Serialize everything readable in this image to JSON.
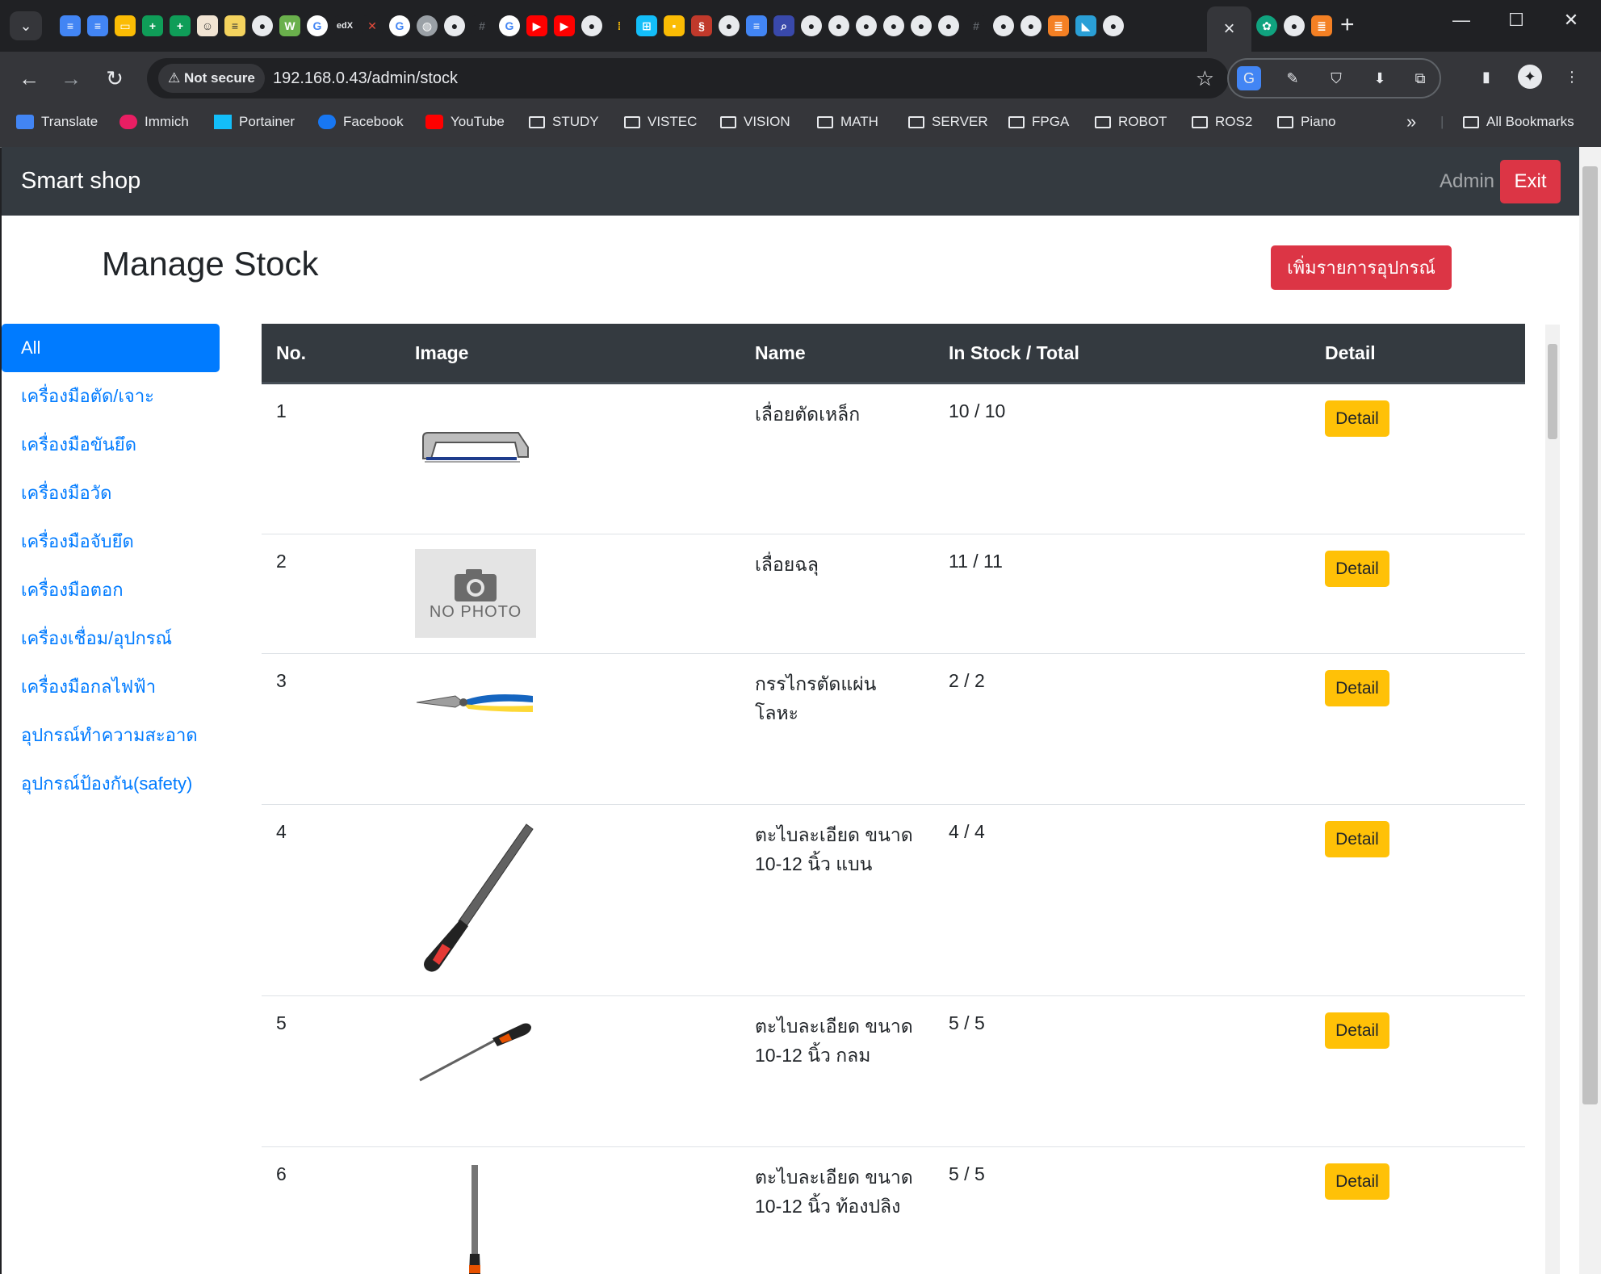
{
  "browser": {
    "new_tab": "+",
    "close_tab": "×",
    "security_label": "Not secure",
    "url": "192.168.0.43/admin/stock",
    "bookmarks": [
      {
        "label": "Translate",
        "icon": "google-translate-icon"
      },
      {
        "label": "Immich",
        "icon": "immich-icon"
      },
      {
        "label": "Portainer",
        "icon": "portainer-icon"
      },
      {
        "label": "Facebook",
        "icon": "facebook-icon"
      },
      {
        "label": "YouTube",
        "icon": "youtube-icon"
      },
      {
        "label": "STUDY",
        "icon": "folder-icon"
      },
      {
        "label": "VISTEC",
        "icon": "folder-icon"
      },
      {
        "label": "VISION",
        "icon": "folder-icon"
      },
      {
        "label": "MATH",
        "icon": "folder-icon"
      },
      {
        "label": "SERVER",
        "icon": "folder-icon"
      },
      {
        "label": "FPGA",
        "icon": "folder-icon"
      },
      {
        "label": "ROBOT",
        "icon": "folder-icon"
      },
      {
        "label": "ROS2",
        "icon": "folder-icon"
      },
      {
        "label": "Piano",
        "icon": "folder-icon"
      }
    ],
    "all_bookmarks": "All Bookmarks",
    "more_bookmarks": "»"
  },
  "app": {
    "brand": "Smart shop",
    "admin_label": "Admin",
    "exit_label": "Exit",
    "page_title": "Manage Stock",
    "add_button": "เพิ่มรายการอุปกรณ์"
  },
  "sidebar": {
    "items": [
      {
        "label": "All",
        "active": true
      },
      {
        "label": "เครื่องมือตัด/เจาะ"
      },
      {
        "label": "เครื่องมือขันยึด"
      },
      {
        "label": "เครื่องมือวัด"
      },
      {
        "label": "เครื่องมือจับยึด"
      },
      {
        "label": "เครื่องมือตอก"
      },
      {
        "label": "เครื่องเชื่อม/อุปกรณ์"
      },
      {
        "label": "เครื่องมือกลไฟฟ้า"
      },
      {
        "label": "อุปกรณ์ทำความสะอาด"
      },
      {
        "label": "อุปกรณ์ป้องกัน(safety)"
      }
    ]
  },
  "table": {
    "headers": {
      "no": "No.",
      "image": "Image",
      "name": "Name",
      "stock": "In Stock / Total",
      "detail": "Detail"
    },
    "detail_label": "Detail",
    "no_photo": "NO PHOTO",
    "rows": [
      {
        "no": "1",
        "image": "hacksaw",
        "name": "เลื่อยตัดเหล็ก",
        "stock": "10 / 10"
      },
      {
        "no": "2",
        "image": "no-photo",
        "name": "เลื่อยฉลุ",
        "stock": "11 / 11"
      },
      {
        "no": "3",
        "image": "tin-snips",
        "name": "กรรไกรตัดแผ่นโลหะ",
        "stock": "2 / 2"
      },
      {
        "no": "4",
        "image": "flat-file",
        "name": "ตะไบละเอียด ขนาด 10-12 นิ้ว แบน",
        "stock": "4 / 4"
      },
      {
        "no": "5",
        "image": "round-file",
        "name": "ตะไบละเอียด ขนาด 10-12 นิ้ว กลม",
        "stock": "5 / 5"
      },
      {
        "no": "6",
        "image": "half-round-file",
        "name": "ตะไบละเอียด ขนาด 10-12 นิ้ว ท้องปลิง",
        "stock": "5 / 5"
      }
    ]
  }
}
